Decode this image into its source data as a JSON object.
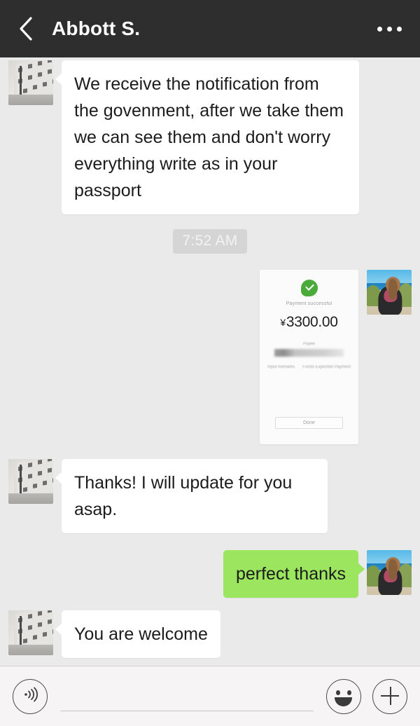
{
  "header": {
    "title": "Abbott S.",
    "back_icon": "chevron-left-icon",
    "more_icon": "more-dots-icon"
  },
  "conversation": {
    "messages": [
      {
        "id": "msg-1",
        "direction": "incoming",
        "type": "text",
        "text": "We receive the notification from the govenment, after we take them we can see them and don't worry everything write as in your passport",
        "avatar": "building-photo-avatar"
      },
      {
        "id": "msg-timestamp-1",
        "type": "timestamp",
        "text": "7:52 AM"
      },
      {
        "id": "msg-2",
        "direction": "outgoing",
        "type": "image",
        "avatar": "beach-photo-avatar",
        "image": {
          "kind": "payment-receipt-screenshot",
          "status_icon": "green-check-icon",
          "status_text": "Payment successful",
          "currency_symbol": "¥",
          "amount": "3300.00",
          "amount_full": "¥3300.00",
          "sub_label": "Payee",
          "redacted_field": "",
          "meta_left": "Input Remarks",
          "meta_right": "Funds Expected Payment",
          "done_label": "Done"
        }
      },
      {
        "id": "msg-3",
        "direction": "incoming",
        "type": "text",
        "text": "Thanks! I will update for you asap.",
        "avatar": "building-photo-avatar"
      },
      {
        "id": "msg-4",
        "direction": "outgoing",
        "type": "text",
        "text": "perfect thanks",
        "avatar": "beach-photo-avatar"
      },
      {
        "id": "msg-5",
        "direction": "incoming",
        "type": "text",
        "text": "You are welcome",
        "avatar": "building-photo-avatar"
      }
    ]
  },
  "inputbar": {
    "voice_icon": "voice-record-icon",
    "input_value": "",
    "input_placeholder": "",
    "emoji_icon": "smiley-icon",
    "plus_icon": "plus-icon"
  },
  "colors": {
    "header_bg": "#2e2e2e",
    "chat_bg": "#ebeaea",
    "incoming_bubble": "#ffffff",
    "outgoing_bubble": "#9be55f",
    "timestamp_bg": "#d6d5d5",
    "inputbar_bg": "#f6f4f5",
    "accent_green": "#4aab3b"
  }
}
